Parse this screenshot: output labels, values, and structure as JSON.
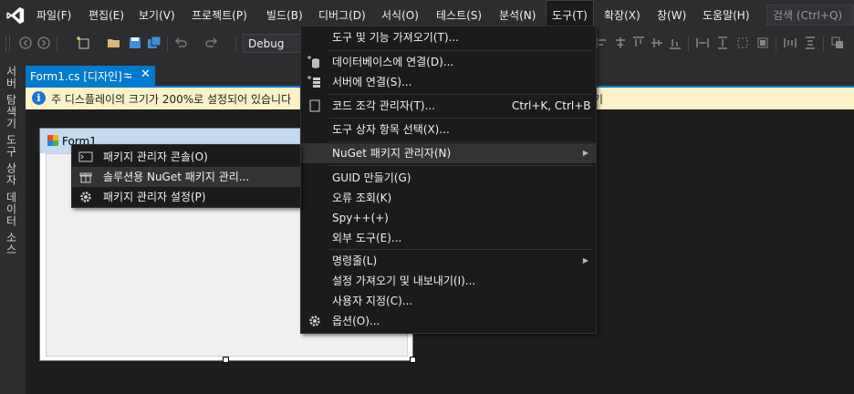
{
  "menubar": {
    "items": [
      {
        "label": "파일(F)"
      },
      {
        "label": "편집(E)"
      },
      {
        "label": "보기(V)"
      },
      {
        "label": "프로젝트(P)"
      },
      {
        "label": "빌드(B)"
      },
      {
        "label": "디버그(D)"
      },
      {
        "label": "서식(O)"
      },
      {
        "label": "테스트(S)"
      },
      {
        "label": "분석(N)"
      },
      {
        "label": "도구(T)"
      },
      {
        "label": "확장(X)"
      },
      {
        "label": "창(W)"
      },
      {
        "label": "도움말(H)"
      }
    ],
    "search_placeholder": "검색 (Ctrl+Q)"
  },
  "toolbar": {
    "configuration": "Debug"
  },
  "left_strip": {
    "tabs": [
      {
        "label": "서버 탐색기"
      },
      {
        "label": "도구 상자"
      },
      {
        "label": "데이터 소스"
      }
    ]
  },
  "document_tab": {
    "label": "Form1.cs [디자인]"
  },
  "infobar": {
    "message": "주 디스플레이의 크기가 200%로 설정되어 있습니다",
    "tail": "기"
  },
  "form": {
    "title": "Form1"
  },
  "tools_menu": {
    "items": [
      {
        "label": "도구 및 기능 가져오기(T)...",
        "icon": "none"
      },
      {
        "label": "데이터베이스에 연결(D)...",
        "icon": "database-connect-icon"
      },
      {
        "label": "서버에 연결(S)...",
        "icon": "server-connect-icon"
      },
      {
        "label": "코드 조각 관리자(T)...",
        "shortcut": "Ctrl+K, Ctrl+B",
        "icon": "snippet-icon"
      },
      {
        "label": "도구 상자 항목 선택(X)...",
        "icon": "none"
      },
      {
        "label": "NuGet 패키지 관리자(N)",
        "icon": "none",
        "submenu": true
      },
      {
        "label": "GUID 만들기(G)",
        "icon": "none"
      },
      {
        "label": "오류 조회(K)",
        "icon": "none"
      },
      {
        "label": "Spy++(+)",
        "icon": "none"
      },
      {
        "label": "외부 도구(E)...",
        "icon": "none"
      },
      {
        "label": "명령줄(L)",
        "icon": "none",
        "submenu": true
      },
      {
        "label": "설정 가져오기 및 내보내기(I)...",
        "icon": "none"
      },
      {
        "label": "사용자 지정(C)...",
        "icon": "none"
      },
      {
        "label": "옵션(O)...",
        "icon": "gear-icon"
      }
    ]
  },
  "nuget_submenu": {
    "items": [
      {
        "label": "패키지 관리자 콘솔(O)",
        "icon": "console-icon"
      },
      {
        "label": "솔루션용 NuGet 패키지 관리...",
        "icon": "package-icon"
      },
      {
        "label": "패키지 관리자 설정(P)",
        "icon": "gear-icon"
      }
    ]
  },
  "colors": {
    "accent": "#007acc",
    "background": "#2d2d30",
    "menu_bg": "#1b1b1c",
    "infobar": "#fcf2c8"
  }
}
